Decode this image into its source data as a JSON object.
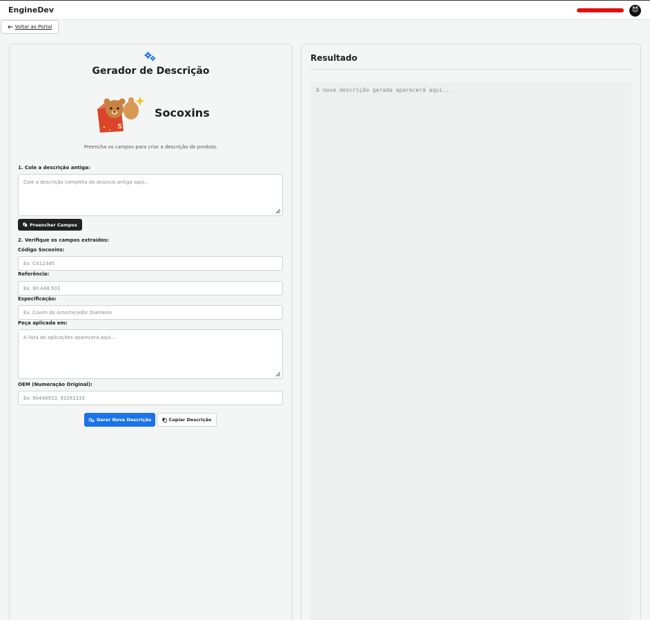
{
  "header": {
    "brand": "EngineDev",
    "avatar_glyph": "😈"
  },
  "nav": {
    "back_label": "Voltar ao Portal",
    "back_icon": "arrow-left-icon"
  },
  "form": {
    "title": "Gerador de Descrição",
    "logo_text": "Socoxins",
    "subtitle": "Preencha os campos para criar a descrição do produto.",
    "step1_label": "1. Cole a descrição antiga:",
    "old_description_placeholder": "Cole a descrição completa do anúncio antigo aqui...",
    "fill_button_label": "Preencher Campos",
    "step2_label": "2. Verifique os campos extraídos:",
    "fields": {
      "code_label": "Código Socoxins:",
      "code_placeholder": "Ex: CX12345",
      "reference_label": "Referência:",
      "reference_placeholder": "Ex: 90.448.933",
      "spec_label": "Especificação:",
      "spec_placeholder": "Ex: Coxim do Amortecedor Dianteiro",
      "applied_label": "Peça aplicada em:",
      "applied_placeholder": "A lista de aplicações aparecerá aqui...",
      "oem_label": "OEM (Numeração Original):",
      "oem_placeholder": "Ex: 90448933, 93281333"
    },
    "generate_button_label": "Gerar Nova Descrição",
    "copy_button_label": "Copiar Descrição"
  },
  "result": {
    "title": "Resultado",
    "placeholder": "A nova descrição gerada aparecerá aqui..."
  },
  "colors": {
    "primary": "#1a73e8",
    "dark_button": "#222222",
    "redaction": "#e01010"
  }
}
